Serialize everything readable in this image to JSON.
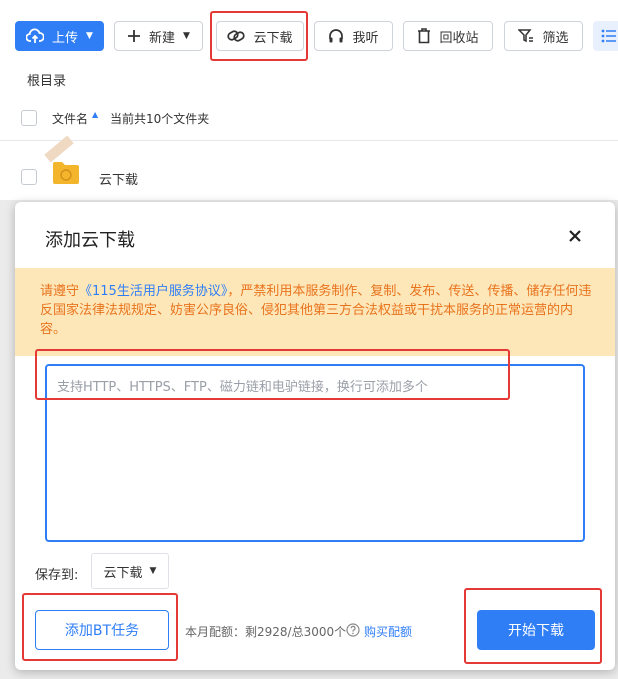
{
  "toolbar": {
    "upload_label": "上传",
    "new_label": "新建",
    "cloud_download_label": "云下载",
    "listen_label": "我听",
    "recycle_label": "回收站",
    "filter_label": "筛选"
  },
  "breadcrumb": {
    "root": "根目录"
  },
  "list": {
    "header_name": "文件名",
    "header_count": "当前共10个文件夹",
    "rows": [
      {
        "name": "云下载"
      }
    ]
  },
  "modal": {
    "title": "添加云下载",
    "notice": {
      "prefix": "请遵守",
      "link": "《115生活用户服务协议》",
      "suffix": "，严禁利用本服务制作、复制、发布、传送、传播、储存任何违反国家法律法规规定、妨害公序良俗、侵犯其他第三方合法权益或干扰本服务的正常运营的内容。"
    },
    "input": {
      "placeholder": "支持HTTP、HTTPS、FTP、磁力链和电驴链接，换行可添加多个",
      "value": ""
    },
    "save_to_label": "保存到:",
    "save_to_value": "云下载",
    "bt_button": "添加BT任务",
    "quota_text": "本月配额：剩2928/总3000个",
    "buy_link": "购买配额",
    "start_button": "开始下载"
  },
  "colors": {
    "accent": "#2f7ef5",
    "notice_bg": "#fde7b9",
    "notice_text": "#e8731d",
    "highlight": "#e53935"
  }
}
